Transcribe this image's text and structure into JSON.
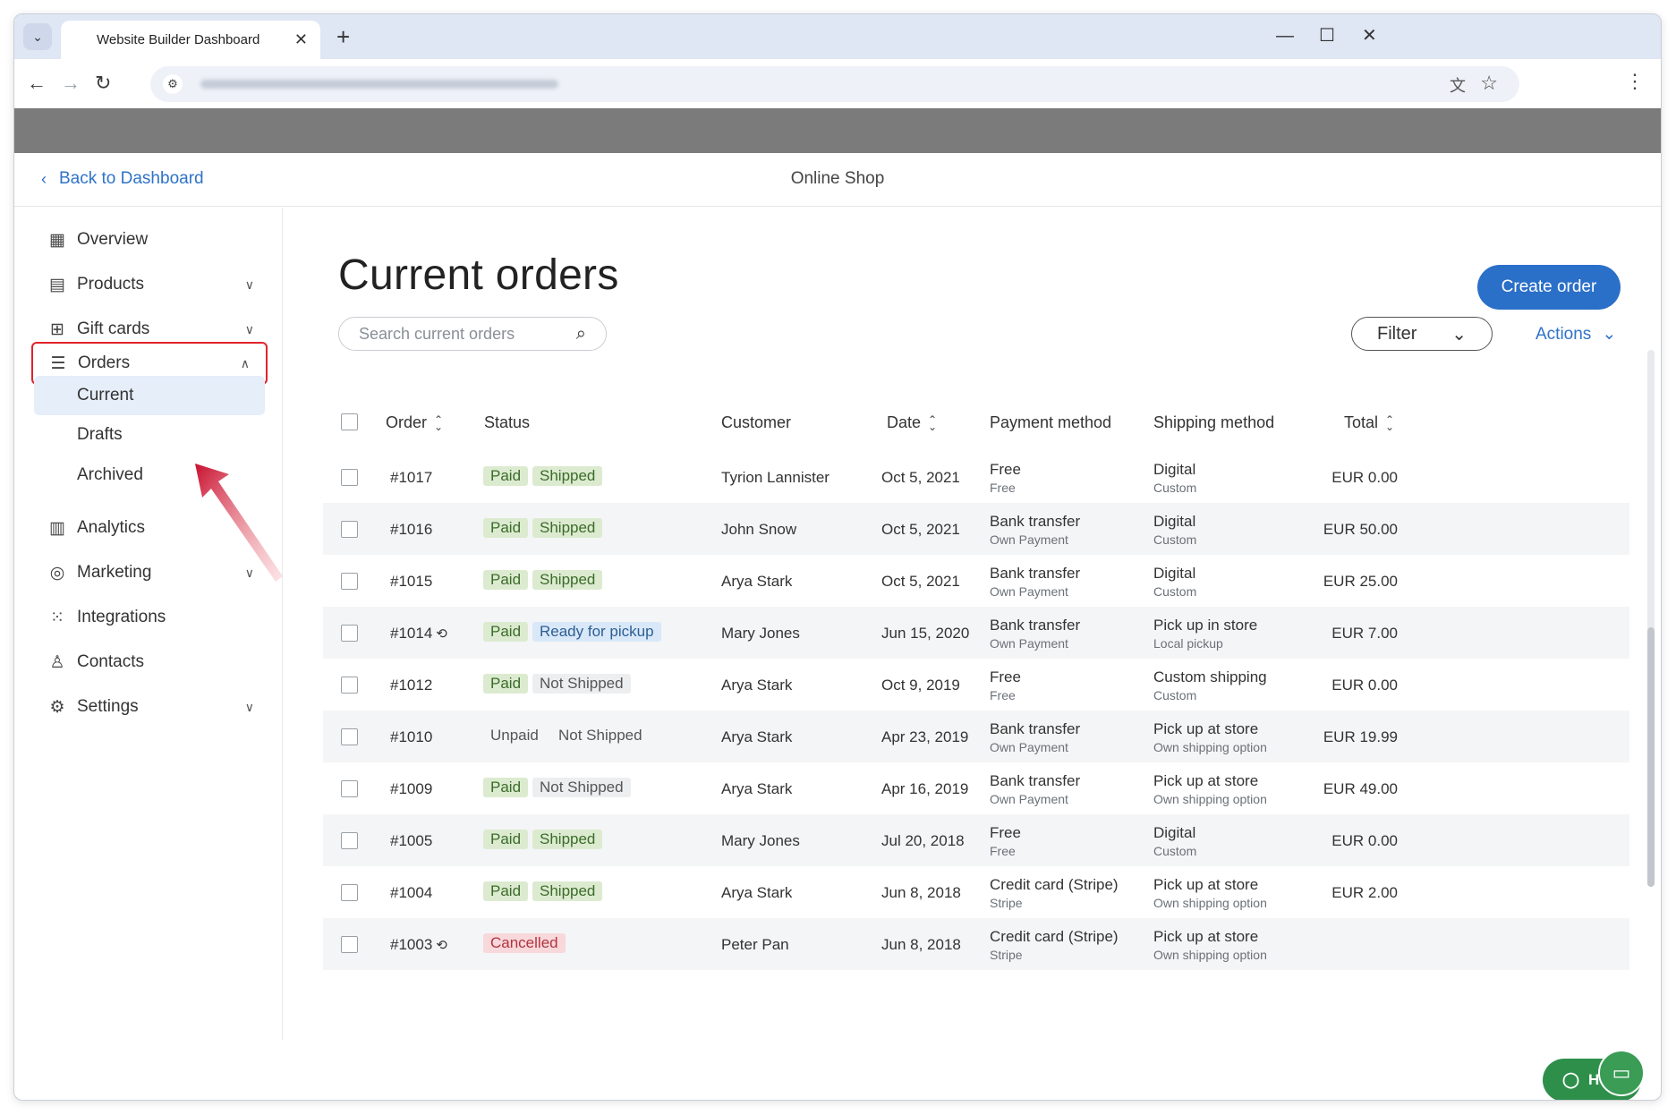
{
  "browser": {
    "tab_title": "Website Builder Dashboard",
    "tab_close": "✕",
    "new_tab": "+",
    "minimize": "—",
    "maximize": "☐",
    "close": "✕"
  },
  "header": {
    "back_label": "Back to Dashboard",
    "title": "Online Shop"
  },
  "sidebar": {
    "items": [
      {
        "label": "Overview",
        "icon": "overview-icon"
      },
      {
        "label": "Products",
        "icon": "products-icon"
      },
      {
        "label": "Gift cards",
        "icon": "gift-icon"
      },
      {
        "label": "Orders",
        "icon": "orders-icon"
      },
      {
        "label": "Analytics",
        "icon": "analytics-icon"
      },
      {
        "label": "Marketing",
        "icon": "marketing-icon"
      },
      {
        "label": "Integrations",
        "icon": "integrations-icon"
      },
      {
        "label": "Contacts",
        "icon": "contacts-icon"
      },
      {
        "label": "Settings",
        "icon": "settings-icon"
      }
    ],
    "orders_sub": [
      "Current",
      "Drafts",
      "Archived"
    ]
  },
  "main": {
    "title": "Current orders",
    "search_placeholder": "Search current orders",
    "create_button": "Create order",
    "filter_button": "Filter",
    "actions_link": "Actions",
    "help_label": "H"
  },
  "table": {
    "headers": {
      "order": "Order",
      "status": "Status",
      "customer": "Customer",
      "date": "Date",
      "payment": "Payment method",
      "shipping": "Shipping method",
      "total": "Total"
    },
    "rows": [
      {
        "order": "#1017",
        "refund": false,
        "status1": "Paid",
        "status2": "Shipped",
        "customer": "Tyrion Lannister",
        "date": "Oct 5, 2021",
        "pay1": "Free",
        "pay2": "Free",
        "ship1": "Digital",
        "ship2": "Custom",
        "total": "EUR 0.00"
      },
      {
        "order": "#1016",
        "refund": false,
        "status1": "Paid",
        "status2": "Shipped",
        "customer": "John Snow",
        "date": "Oct 5, 2021",
        "pay1": "Bank transfer",
        "pay2": "Own Payment",
        "ship1": "Digital",
        "ship2": "Custom",
        "total": "EUR 50.00"
      },
      {
        "order": "#1015",
        "refund": false,
        "status1": "Paid",
        "status2": "Shipped",
        "customer": "Arya Stark",
        "date": "Oct 5, 2021",
        "pay1": "Bank transfer",
        "pay2": "Own Payment",
        "ship1": "Digital",
        "ship2": "Custom",
        "total": "EUR 25.00"
      },
      {
        "order": "#1014",
        "refund": true,
        "status1": "Paid",
        "status2": "Ready for pickup",
        "customer": "Mary Jones",
        "date": "Jun 15, 2020",
        "pay1": "Bank transfer",
        "pay2": "Own Payment",
        "ship1": "Pick up in store",
        "ship2": "Local pickup",
        "total": "EUR 7.00"
      },
      {
        "order": "#1012",
        "refund": false,
        "status1": "Paid",
        "status2": "Not Shipped",
        "customer": "Arya Stark",
        "date": "Oct 9, 2019",
        "pay1": "Free",
        "pay2": "Free",
        "ship1": "Custom shipping",
        "ship2": "Custom",
        "total": "EUR 0.00"
      },
      {
        "order": "#1010",
        "refund": false,
        "status1": "Unpaid",
        "status2": "Not Shipped",
        "customer": "Arya Stark",
        "date": "Apr 23, 2019",
        "pay1": "Bank transfer",
        "pay2": "Own Payment",
        "ship1": "Pick up at store",
        "ship2": "Own shipping option",
        "total": "EUR 19.99"
      },
      {
        "order": "#1009",
        "refund": false,
        "status1": "Paid",
        "status2": "Not Shipped",
        "customer": "Arya Stark",
        "date": "Apr 16, 2019",
        "pay1": "Bank transfer",
        "pay2": "Own Payment",
        "ship1": "Pick up at store",
        "ship2": "Own shipping option",
        "total": "EUR 49.00"
      },
      {
        "order": "#1005",
        "refund": false,
        "status1": "Paid",
        "status2": "Shipped",
        "customer": "Mary Jones",
        "date": "Jul 20, 2018",
        "pay1": "Free",
        "pay2": "Free",
        "ship1": "Digital",
        "ship2": "Custom",
        "total": "EUR 0.00"
      },
      {
        "order": "#1004",
        "refund": false,
        "status1": "Paid",
        "status2": "Shipped",
        "customer": "Arya Stark",
        "date": "Jun 8, 2018",
        "pay1": "Credit card (Stripe)",
        "pay2": "Stripe",
        "ship1": "Pick up at store",
        "ship2": "Own shipping option",
        "total": "EUR 2.00"
      },
      {
        "order": "#1003",
        "refund": true,
        "status1": "Cancelled",
        "status2": "",
        "customer": "Peter Pan",
        "date": "Jun 8, 2018",
        "pay1": "Credit card (Stripe)",
        "pay2": "Stripe",
        "ship1": "Pick up at store",
        "ship2": "Own shipping option",
        "total": ""
      }
    ]
  },
  "colors": {
    "accent": "#2a6fc8",
    "highlight_border": "#e2232b",
    "paid_badge": "#dcebd0",
    "ready_badge": "#d9e8f8",
    "cancelled_badge": "#f8d8da",
    "help_button": "#2e8f4a"
  }
}
